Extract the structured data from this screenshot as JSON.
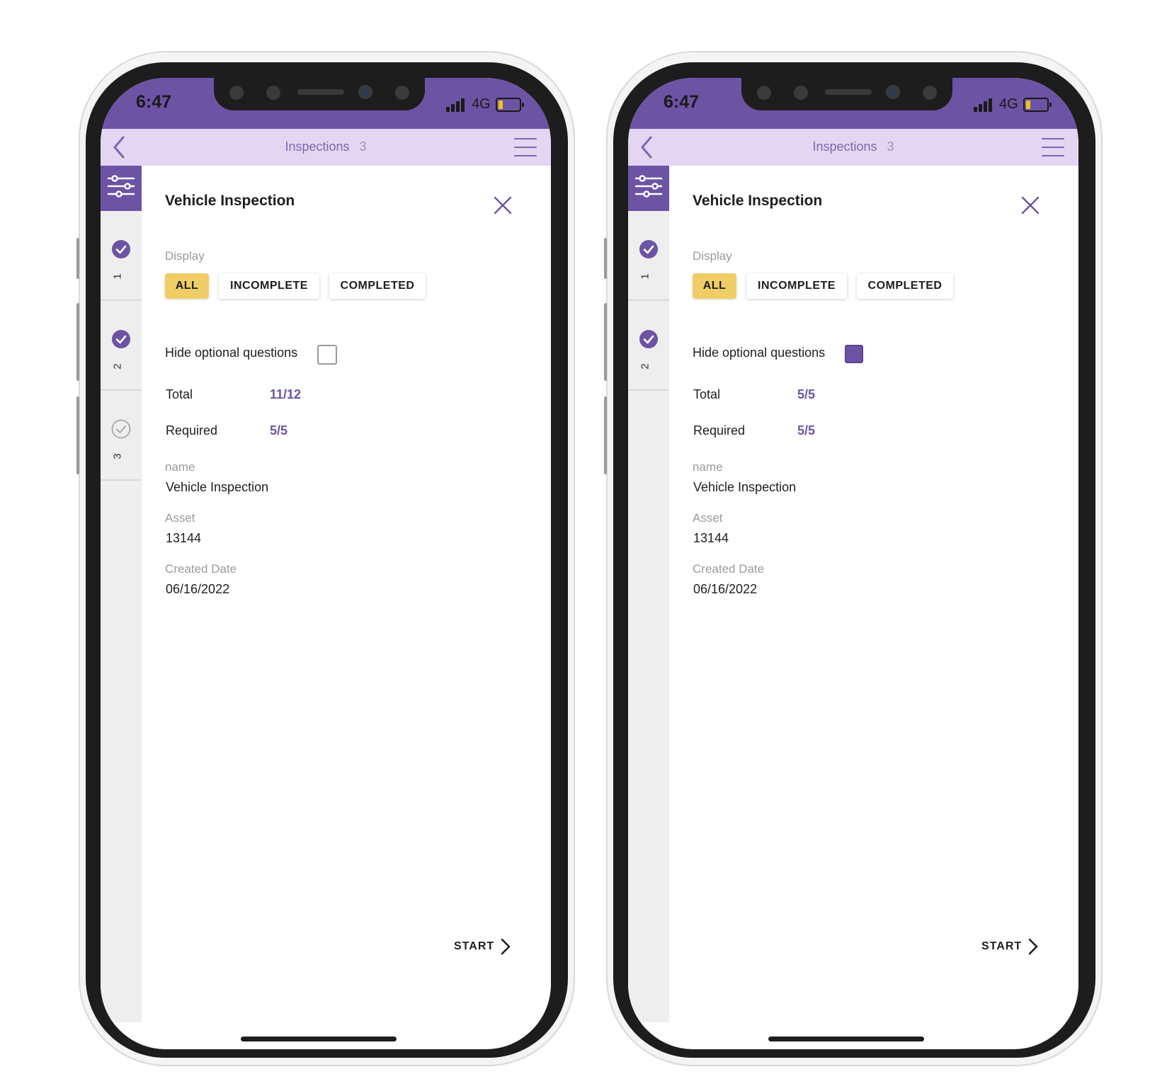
{
  "phones": [
    {
      "status": {
        "time": "6:47",
        "network": "4G"
      },
      "nav": {
        "title": "Inspections",
        "count": "3"
      },
      "steps": [
        {
          "number": "1",
          "state": "complete"
        },
        {
          "number": "2",
          "state": "complete"
        },
        {
          "number": "3",
          "state": "pending"
        }
      ],
      "title": "Vehicle Inspection",
      "display_label": "Display",
      "filters": [
        "ALL",
        "INCOMPLETE",
        "COMPLETED"
      ],
      "selected_filter": "ALL",
      "hide_optional_label": "Hide optional questions",
      "hide_optional_checked": false,
      "total_label": "Total",
      "total_value": "11/12",
      "required_label": "Required",
      "required_value": "5/5",
      "fields": [
        {
          "label": "name",
          "value": "Vehicle Inspection"
        },
        {
          "label": "Asset",
          "value": "13144"
        },
        {
          "label": "Created Date",
          "value": "06/16/2022"
        }
      ],
      "start_label": "START"
    },
    {
      "status": {
        "time": "6:47",
        "network": "4G"
      },
      "nav": {
        "title": "Inspections",
        "count": "3"
      },
      "steps": [
        {
          "number": "1",
          "state": "complete"
        },
        {
          "number": "2",
          "state": "complete"
        }
      ],
      "title": "Vehicle Inspection",
      "display_label": "Display",
      "filters": [
        "ALL",
        "INCOMPLETE",
        "COMPLETED"
      ],
      "selected_filter": "ALL",
      "hide_optional_label": "Hide optional questions",
      "hide_optional_checked": true,
      "total_label": "Total",
      "total_value": "5/5",
      "required_label": "Required",
      "required_value": "5/5",
      "fields": [
        {
          "label": "name",
          "value": "Vehicle Inspection"
        },
        {
          "label": "Asset",
          "value": "13144"
        },
        {
          "label": "Created Date",
          "value": "06/16/2022"
        }
      ],
      "start_label": "START"
    }
  ],
  "colors": {
    "brand_purple": "#6d53a4",
    "nav_lavender": "#e3d6f2",
    "chip_selected": "#efcd67",
    "battery_level": "#f2c21a"
  },
  "icons": [
    "chevron-left-icon",
    "hamburger-menu-icon",
    "filter-sliders-icon",
    "check-circle-icon",
    "close-icon",
    "chevron-right-icon",
    "signal-bars-icon",
    "battery-icon"
  ],
  "battery_level": 0.2
}
